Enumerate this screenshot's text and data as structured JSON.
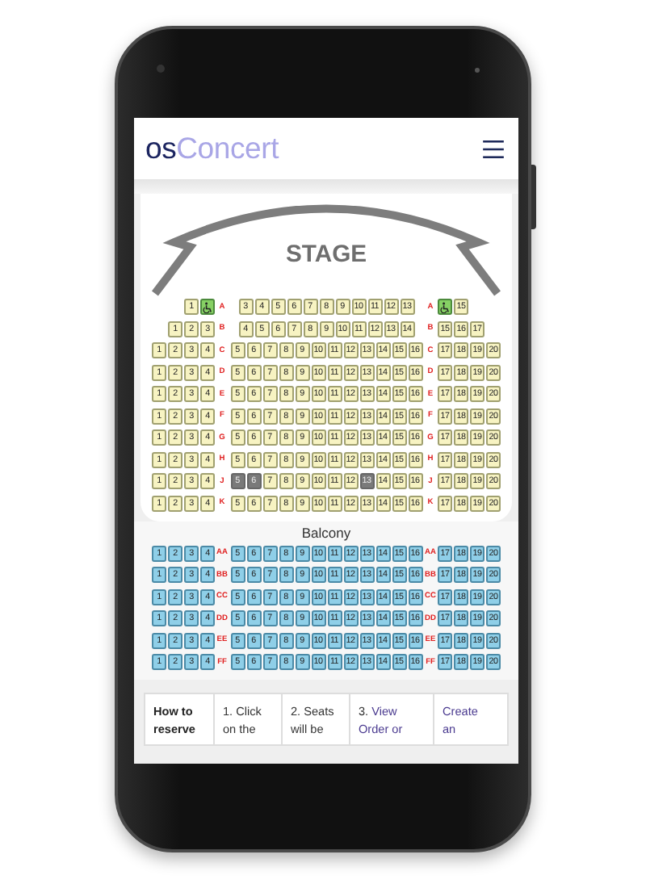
{
  "header": {
    "logo": {
      "dark_part": "os",
      "light_part": "Concert"
    }
  },
  "stage": {
    "label": "STAGE"
  },
  "orchestra": {
    "rows": [
      {
        "label_left": "A",
        "label_right": "A",
        "left": [
          {
            "kind": "seat",
            "label": "1",
            "sold": false
          },
          {
            "kind": "wheelchair",
            "sold": false
          }
        ],
        "center": [
          {
            "kind": "seat",
            "label": "3",
            "sold": false
          },
          {
            "kind": "seat",
            "label": "4",
            "sold": false
          },
          {
            "kind": "seat",
            "label": "5",
            "sold": false
          },
          {
            "kind": "seat",
            "label": "6",
            "sold": false
          },
          {
            "kind": "seat",
            "label": "7",
            "sold": false
          },
          {
            "kind": "seat",
            "label": "8",
            "sold": false
          },
          {
            "kind": "seat",
            "label": "9",
            "sold": false
          },
          {
            "kind": "seat",
            "label": "10",
            "sold": false
          },
          {
            "kind": "seat",
            "label": "11",
            "sold": false
          },
          {
            "kind": "seat",
            "label": "12",
            "sold": false
          },
          {
            "kind": "seat",
            "label": "13",
            "sold": false
          }
        ],
        "right": [
          {
            "kind": "wheelchair",
            "sold": false
          },
          {
            "kind": "seat",
            "label": "15",
            "sold": false
          }
        ]
      },
      {
        "label_left": "B",
        "label_right": "B",
        "left": [
          {
            "kind": "seat",
            "label": "1",
            "sold": false
          },
          {
            "kind": "seat",
            "label": "2",
            "sold": false
          },
          {
            "kind": "seat",
            "label": "3",
            "sold": false
          }
        ],
        "center": [
          {
            "kind": "seat",
            "label": "4",
            "sold": false
          },
          {
            "kind": "seat",
            "label": "5",
            "sold": false
          },
          {
            "kind": "seat",
            "label": "6",
            "sold": false
          },
          {
            "kind": "seat",
            "label": "7",
            "sold": false
          },
          {
            "kind": "seat",
            "label": "8",
            "sold": false
          },
          {
            "kind": "seat",
            "label": "9",
            "sold": false
          },
          {
            "kind": "seat",
            "label": "10",
            "sold": false
          },
          {
            "kind": "seat",
            "label": "11",
            "sold": false
          },
          {
            "kind": "seat",
            "label": "12",
            "sold": false
          },
          {
            "kind": "seat",
            "label": "13",
            "sold": false
          },
          {
            "kind": "seat",
            "label": "14",
            "sold": false
          }
        ],
        "right": [
          {
            "kind": "seat",
            "label": "15",
            "sold": false
          },
          {
            "kind": "seat",
            "label": "16",
            "sold": false
          },
          {
            "kind": "seat",
            "label": "17",
            "sold": false
          }
        ]
      },
      {
        "label_left": "C",
        "label_right": "C",
        "left": [
          {
            "kind": "seat",
            "label": "1",
            "sold": false
          },
          {
            "kind": "seat",
            "label": "2",
            "sold": false
          },
          {
            "kind": "seat",
            "label": "3",
            "sold": false
          },
          {
            "kind": "seat",
            "label": "4",
            "sold": false
          }
        ],
        "center": [
          {
            "kind": "seat",
            "label": "5",
            "sold": false
          },
          {
            "kind": "seat",
            "label": "6",
            "sold": false
          },
          {
            "kind": "seat",
            "label": "7",
            "sold": false
          },
          {
            "kind": "seat",
            "label": "8",
            "sold": false
          },
          {
            "kind": "seat",
            "label": "9",
            "sold": false
          },
          {
            "kind": "seat",
            "label": "10",
            "sold": false
          },
          {
            "kind": "seat",
            "label": "11",
            "sold": false
          },
          {
            "kind": "seat",
            "label": "12",
            "sold": false
          },
          {
            "kind": "seat",
            "label": "13",
            "sold": false
          },
          {
            "kind": "seat",
            "label": "14",
            "sold": false
          },
          {
            "kind": "seat",
            "label": "15",
            "sold": false
          },
          {
            "kind": "seat",
            "label": "16",
            "sold": false
          }
        ],
        "right": [
          {
            "kind": "seat",
            "label": "17",
            "sold": false
          },
          {
            "kind": "seat",
            "label": "18",
            "sold": false
          },
          {
            "kind": "seat",
            "label": "19",
            "sold": false
          },
          {
            "kind": "seat",
            "label": "20",
            "sold": false
          }
        ]
      },
      {
        "label_left": "D",
        "label_right": "D",
        "left": [
          {
            "kind": "seat",
            "label": "1",
            "sold": false
          },
          {
            "kind": "seat",
            "label": "2",
            "sold": false
          },
          {
            "kind": "seat",
            "label": "3",
            "sold": false
          },
          {
            "kind": "seat",
            "label": "4",
            "sold": false
          }
        ],
        "center": [
          {
            "kind": "seat",
            "label": "5",
            "sold": false
          },
          {
            "kind": "seat",
            "label": "6",
            "sold": false
          },
          {
            "kind": "seat",
            "label": "7",
            "sold": false
          },
          {
            "kind": "seat",
            "label": "8",
            "sold": false
          },
          {
            "kind": "seat",
            "label": "9",
            "sold": false
          },
          {
            "kind": "seat",
            "label": "10",
            "sold": false
          },
          {
            "kind": "seat",
            "label": "11",
            "sold": false
          },
          {
            "kind": "seat",
            "label": "12",
            "sold": false
          },
          {
            "kind": "seat",
            "label": "13",
            "sold": false
          },
          {
            "kind": "seat",
            "label": "14",
            "sold": false
          },
          {
            "kind": "seat",
            "label": "15",
            "sold": false
          },
          {
            "kind": "seat",
            "label": "16",
            "sold": false
          }
        ],
        "right": [
          {
            "kind": "seat",
            "label": "17",
            "sold": false
          },
          {
            "kind": "seat",
            "label": "18",
            "sold": false
          },
          {
            "kind": "seat",
            "label": "19",
            "sold": false
          },
          {
            "kind": "seat",
            "label": "20",
            "sold": false
          }
        ]
      },
      {
        "label_left": "E",
        "label_right": "E",
        "left": [
          {
            "kind": "seat",
            "label": "1",
            "sold": false
          },
          {
            "kind": "seat",
            "label": "2",
            "sold": false
          },
          {
            "kind": "seat",
            "label": "3",
            "sold": false
          },
          {
            "kind": "seat",
            "label": "4",
            "sold": false
          }
        ],
        "center": [
          {
            "kind": "seat",
            "label": "5",
            "sold": false
          },
          {
            "kind": "seat",
            "label": "6",
            "sold": false
          },
          {
            "kind": "seat",
            "label": "7",
            "sold": false
          },
          {
            "kind": "seat",
            "label": "8",
            "sold": false
          },
          {
            "kind": "seat",
            "label": "9",
            "sold": false
          },
          {
            "kind": "seat",
            "label": "10",
            "sold": false
          },
          {
            "kind": "seat",
            "label": "11",
            "sold": false
          },
          {
            "kind": "seat",
            "label": "12",
            "sold": false
          },
          {
            "kind": "seat",
            "label": "13",
            "sold": false
          },
          {
            "kind": "seat",
            "label": "14",
            "sold": false
          },
          {
            "kind": "seat",
            "label": "15",
            "sold": false
          },
          {
            "kind": "seat",
            "label": "16",
            "sold": false
          }
        ],
        "right": [
          {
            "kind": "seat",
            "label": "17",
            "sold": false
          },
          {
            "kind": "seat",
            "label": "18",
            "sold": false
          },
          {
            "kind": "seat",
            "label": "19",
            "sold": false
          },
          {
            "kind": "seat",
            "label": "20",
            "sold": false
          }
        ]
      },
      {
        "label_left": "F",
        "label_right": "F",
        "left": [
          {
            "kind": "seat",
            "label": "1",
            "sold": false
          },
          {
            "kind": "seat",
            "label": "2",
            "sold": false
          },
          {
            "kind": "seat",
            "label": "3",
            "sold": false
          },
          {
            "kind": "seat",
            "label": "4",
            "sold": false
          }
        ],
        "center": [
          {
            "kind": "seat",
            "label": "5",
            "sold": false
          },
          {
            "kind": "seat",
            "label": "6",
            "sold": false
          },
          {
            "kind": "seat",
            "label": "7",
            "sold": false
          },
          {
            "kind": "seat",
            "label": "8",
            "sold": false
          },
          {
            "kind": "seat",
            "label": "9",
            "sold": false
          },
          {
            "kind": "seat",
            "label": "10",
            "sold": false
          },
          {
            "kind": "seat",
            "label": "11",
            "sold": false
          },
          {
            "kind": "seat",
            "label": "12",
            "sold": false
          },
          {
            "kind": "seat",
            "label": "13",
            "sold": false
          },
          {
            "kind": "seat",
            "label": "14",
            "sold": false
          },
          {
            "kind": "seat",
            "label": "15",
            "sold": false
          },
          {
            "kind": "seat",
            "label": "16",
            "sold": false
          }
        ],
        "right": [
          {
            "kind": "seat",
            "label": "17",
            "sold": false
          },
          {
            "kind": "seat",
            "label": "18",
            "sold": false
          },
          {
            "kind": "seat",
            "label": "19",
            "sold": false
          },
          {
            "kind": "seat",
            "label": "20",
            "sold": false
          }
        ]
      },
      {
        "label_left": "G",
        "label_right": "G",
        "left": [
          {
            "kind": "seat",
            "label": "1",
            "sold": false
          },
          {
            "kind": "seat",
            "label": "2",
            "sold": false
          },
          {
            "kind": "seat",
            "label": "3",
            "sold": false
          },
          {
            "kind": "seat",
            "label": "4",
            "sold": false
          }
        ],
        "center": [
          {
            "kind": "seat",
            "label": "5",
            "sold": false
          },
          {
            "kind": "seat",
            "label": "6",
            "sold": false
          },
          {
            "kind": "seat",
            "label": "7",
            "sold": false
          },
          {
            "kind": "seat",
            "label": "8",
            "sold": false
          },
          {
            "kind": "seat",
            "label": "9",
            "sold": false
          },
          {
            "kind": "seat",
            "label": "10",
            "sold": false
          },
          {
            "kind": "seat",
            "label": "11",
            "sold": false
          },
          {
            "kind": "seat",
            "label": "12",
            "sold": false
          },
          {
            "kind": "seat",
            "label": "13",
            "sold": false
          },
          {
            "kind": "seat",
            "label": "14",
            "sold": false
          },
          {
            "kind": "seat",
            "label": "15",
            "sold": false
          },
          {
            "kind": "seat",
            "label": "16",
            "sold": false
          }
        ],
        "right": [
          {
            "kind": "seat",
            "label": "17",
            "sold": false
          },
          {
            "kind": "seat",
            "label": "18",
            "sold": false
          },
          {
            "kind": "seat",
            "label": "19",
            "sold": false
          },
          {
            "kind": "seat",
            "label": "20",
            "sold": false
          }
        ]
      },
      {
        "label_left": "H",
        "label_right": "H",
        "left": [
          {
            "kind": "seat",
            "label": "1",
            "sold": false
          },
          {
            "kind": "seat",
            "label": "2",
            "sold": false
          },
          {
            "kind": "seat",
            "label": "3",
            "sold": false
          },
          {
            "kind": "seat",
            "label": "4",
            "sold": false
          }
        ],
        "center": [
          {
            "kind": "seat",
            "label": "5",
            "sold": false
          },
          {
            "kind": "seat",
            "label": "6",
            "sold": false
          },
          {
            "kind": "seat",
            "label": "7",
            "sold": false
          },
          {
            "kind": "seat",
            "label": "8",
            "sold": false
          },
          {
            "kind": "seat",
            "label": "9",
            "sold": false
          },
          {
            "kind": "seat",
            "label": "10",
            "sold": false
          },
          {
            "kind": "seat",
            "label": "11",
            "sold": false
          },
          {
            "kind": "seat",
            "label": "12",
            "sold": false
          },
          {
            "kind": "seat",
            "label": "13",
            "sold": false
          },
          {
            "kind": "seat",
            "label": "14",
            "sold": false
          },
          {
            "kind": "seat",
            "label": "15",
            "sold": false
          },
          {
            "kind": "seat",
            "label": "16",
            "sold": false
          }
        ],
        "right": [
          {
            "kind": "seat",
            "label": "17",
            "sold": false
          },
          {
            "kind": "seat",
            "label": "18",
            "sold": false
          },
          {
            "kind": "seat",
            "label": "19",
            "sold": false
          },
          {
            "kind": "seat",
            "label": "20",
            "sold": false
          }
        ]
      },
      {
        "label_left": "J",
        "label_right": "J",
        "left": [
          {
            "kind": "seat",
            "label": "1",
            "sold": false
          },
          {
            "kind": "seat",
            "label": "2",
            "sold": false
          },
          {
            "kind": "seat",
            "label": "3",
            "sold": false
          },
          {
            "kind": "seat",
            "label": "4",
            "sold": false
          }
        ],
        "center": [
          {
            "kind": "seat",
            "label": "5",
            "sold": true
          },
          {
            "kind": "seat",
            "label": "6",
            "sold": true
          },
          {
            "kind": "seat",
            "label": "7",
            "sold": false
          },
          {
            "kind": "seat",
            "label": "8",
            "sold": false
          },
          {
            "kind": "seat",
            "label": "9",
            "sold": false
          },
          {
            "kind": "seat",
            "label": "10",
            "sold": false
          },
          {
            "kind": "seat",
            "label": "11",
            "sold": false
          },
          {
            "kind": "seat",
            "label": "12",
            "sold": false
          },
          {
            "kind": "seat",
            "label": "13",
            "sold": true
          },
          {
            "kind": "seat",
            "label": "14",
            "sold": false
          },
          {
            "kind": "seat",
            "label": "15",
            "sold": false
          },
          {
            "kind": "seat",
            "label": "16",
            "sold": false
          }
        ],
        "right": [
          {
            "kind": "seat",
            "label": "17",
            "sold": false
          },
          {
            "kind": "seat",
            "label": "18",
            "sold": false
          },
          {
            "kind": "seat",
            "label": "19",
            "sold": false
          },
          {
            "kind": "seat",
            "label": "20",
            "sold": false
          }
        ]
      },
      {
        "label_left": "K",
        "label_right": "K",
        "left": [
          {
            "kind": "seat",
            "label": "1",
            "sold": false
          },
          {
            "kind": "seat",
            "label": "2",
            "sold": false
          },
          {
            "kind": "seat",
            "label": "3",
            "sold": false
          },
          {
            "kind": "seat",
            "label": "4",
            "sold": false
          }
        ],
        "center": [
          {
            "kind": "seat",
            "label": "5",
            "sold": false
          },
          {
            "kind": "seat",
            "label": "6",
            "sold": false
          },
          {
            "kind": "seat",
            "label": "7",
            "sold": false
          },
          {
            "kind": "seat",
            "label": "8",
            "sold": false
          },
          {
            "kind": "seat",
            "label": "9",
            "sold": false
          },
          {
            "kind": "seat",
            "label": "10",
            "sold": false
          },
          {
            "kind": "seat",
            "label": "11",
            "sold": false
          },
          {
            "kind": "seat",
            "label": "12",
            "sold": false
          },
          {
            "kind": "seat",
            "label": "13",
            "sold": false
          },
          {
            "kind": "seat",
            "label": "14",
            "sold": false
          },
          {
            "kind": "seat",
            "label": "15",
            "sold": false
          },
          {
            "kind": "seat",
            "label": "16",
            "sold": false
          }
        ],
        "right": [
          {
            "kind": "seat",
            "label": "17",
            "sold": false
          },
          {
            "kind": "seat",
            "label": "18",
            "sold": false
          },
          {
            "kind": "seat",
            "label": "19",
            "sold": false
          },
          {
            "kind": "seat",
            "label": "20",
            "sold": false
          }
        ]
      }
    ]
  },
  "balcony": {
    "title": "Balcony",
    "rows": [
      {
        "label_left": "AA",
        "label_right": "AA",
        "left": [
          {
            "kind": "seat",
            "label": "1",
            "sold": false
          },
          {
            "kind": "seat",
            "label": "2",
            "sold": false
          },
          {
            "kind": "seat",
            "label": "3",
            "sold": false
          },
          {
            "kind": "seat",
            "label": "4",
            "sold": false
          }
        ],
        "center": [
          {
            "kind": "seat",
            "label": "5",
            "sold": false
          },
          {
            "kind": "seat",
            "label": "6",
            "sold": false
          },
          {
            "kind": "seat",
            "label": "7",
            "sold": false
          },
          {
            "kind": "seat",
            "label": "8",
            "sold": false
          },
          {
            "kind": "seat",
            "label": "9",
            "sold": false
          },
          {
            "kind": "seat",
            "label": "10",
            "sold": false
          },
          {
            "kind": "seat",
            "label": "11",
            "sold": false
          },
          {
            "kind": "seat",
            "label": "12",
            "sold": false
          },
          {
            "kind": "seat",
            "label": "13",
            "sold": false
          },
          {
            "kind": "seat",
            "label": "14",
            "sold": false
          },
          {
            "kind": "seat",
            "label": "15",
            "sold": false
          },
          {
            "kind": "seat",
            "label": "16",
            "sold": false
          }
        ],
        "right": [
          {
            "kind": "seat",
            "label": "17",
            "sold": false
          },
          {
            "kind": "seat",
            "label": "18",
            "sold": false
          },
          {
            "kind": "seat",
            "label": "19",
            "sold": false
          },
          {
            "kind": "seat",
            "label": "20",
            "sold": false
          }
        ]
      },
      {
        "label_left": "BB",
        "label_right": "BB",
        "left": [
          {
            "kind": "seat",
            "label": "1",
            "sold": false
          },
          {
            "kind": "seat",
            "label": "2",
            "sold": false
          },
          {
            "kind": "seat",
            "label": "3",
            "sold": false
          },
          {
            "kind": "seat",
            "label": "4",
            "sold": false
          }
        ],
        "center": [
          {
            "kind": "seat",
            "label": "5",
            "sold": false
          },
          {
            "kind": "seat",
            "label": "6",
            "sold": false
          },
          {
            "kind": "seat",
            "label": "7",
            "sold": false
          },
          {
            "kind": "seat",
            "label": "8",
            "sold": false
          },
          {
            "kind": "seat",
            "label": "9",
            "sold": false
          },
          {
            "kind": "seat",
            "label": "10",
            "sold": false
          },
          {
            "kind": "seat",
            "label": "11",
            "sold": false
          },
          {
            "kind": "seat",
            "label": "12",
            "sold": false
          },
          {
            "kind": "seat",
            "label": "13",
            "sold": false
          },
          {
            "kind": "seat",
            "label": "14",
            "sold": false
          },
          {
            "kind": "seat",
            "label": "15",
            "sold": false
          },
          {
            "kind": "seat",
            "label": "16",
            "sold": false
          }
        ],
        "right": [
          {
            "kind": "seat",
            "label": "17",
            "sold": false
          },
          {
            "kind": "seat",
            "label": "18",
            "sold": false
          },
          {
            "kind": "seat",
            "label": "19",
            "sold": false
          },
          {
            "kind": "seat",
            "label": "20",
            "sold": false
          }
        ]
      },
      {
        "label_left": "CC",
        "label_right": "CC",
        "left": [
          {
            "kind": "seat",
            "label": "1",
            "sold": false
          },
          {
            "kind": "seat",
            "label": "2",
            "sold": false
          },
          {
            "kind": "seat",
            "label": "3",
            "sold": false
          },
          {
            "kind": "seat",
            "label": "4",
            "sold": false
          }
        ],
        "center": [
          {
            "kind": "seat",
            "label": "5",
            "sold": false
          },
          {
            "kind": "seat",
            "label": "6",
            "sold": false
          },
          {
            "kind": "seat",
            "label": "7",
            "sold": false
          },
          {
            "kind": "seat",
            "label": "8",
            "sold": false
          },
          {
            "kind": "seat",
            "label": "9",
            "sold": false
          },
          {
            "kind": "seat",
            "label": "10",
            "sold": false
          },
          {
            "kind": "seat",
            "label": "11",
            "sold": false
          },
          {
            "kind": "seat",
            "label": "12",
            "sold": false
          },
          {
            "kind": "seat",
            "label": "13",
            "sold": false
          },
          {
            "kind": "seat",
            "label": "14",
            "sold": false
          },
          {
            "kind": "seat",
            "label": "15",
            "sold": false
          },
          {
            "kind": "seat",
            "label": "16",
            "sold": false
          }
        ],
        "right": [
          {
            "kind": "seat",
            "label": "17",
            "sold": false
          },
          {
            "kind": "seat",
            "label": "18",
            "sold": false
          },
          {
            "kind": "seat",
            "label": "19",
            "sold": false
          },
          {
            "kind": "seat",
            "label": "20",
            "sold": false
          }
        ]
      },
      {
        "label_left": "DD",
        "label_right": "DD",
        "left": [
          {
            "kind": "seat",
            "label": "1",
            "sold": false
          },
          {
            "kind": "seat",
            "label": "2",
            "sold": false
          },
          {
            "kind": "seat",
            "label": "3",
            "sold": false
          },
          {
            "kind": "seat",
            "label": "4",
            "sold": false
          }
        ],
        "center": [
          {
            "kind": "seat",
            "label": "5",
            "sold": false
          },
          {
            "kind": "seat",
            "label": "6",
            "sold": false
          },
          {
            "kind": "seat",
            "label": "7",
            "sold": false
          },
          {
            "kind": "seat",
            "label": "8",
            "sold": false
          },
          {
            "kind": "seat",
            "label": "9",
            "sold": false
          },
          {
            "kind": "seat",
            "label": "10",
            "sold": false
          },
          {
            "kind": "seat",
            "label": "11",
            "sold": false
          },
          {
            "kind": "seat",
            "label": "12",
            "sold": false
          },
          {
            "kind": "seat",
            "label": "13",
            "sold": false
          },
          {
            "kind": "seat",
            "label": "14",
            "sold": false
          },
          {
            "kind": "seat",
            "label": "15",
            "sold": false
          },
          {
            "kind": "seat",
            "label": "16",
            "sold": false
          }
        ],
        "right": [
          {
            "kind": "seat",
            "label": "17",
            "sold": false
          },
          {
            "kind": "seat",
            "label": "18",
            "sold": false
          },
          {
            "kind": "seat",
            "label": "19",
            "sold": false
          },
          {
            "kind": "seat",
            "label": "20",
            "sold": false
          }
        ]
      },
      {
        "label_left": "EE",
        "label_right": "EE",
        "left": [
          {
            "kind": "seat",
            "label": "1",
            "sold": false
          },
          {
            "kind": "seat",
            "label": "2",
            "sold": false
          },
          {
            "kind": "seat",
            "label": "3",
            "sold": false
          },
          {
            "kind": "seat",
            "label": "4",
            "sold": false
          }
        ],
        "center": [
          {
            "kind": "seat",
            "label": "5",
            "sold": false
          },
          {
            "kind": "seat",
            "label": "6",
            "sold": false
          },
          {
            "kind": "seat",
            "label": "7",
            "sold": false
          },
          {
            "kind": "seat",
            "label": "8",
            "sold": false
          },
          {
            "kind": "seat",
            "label": "9",
            "sold": false
          },
          {
            "kind": "seat",
            "label": "10",
            "sold": false
          },
          {
            "kind": "seat",
            "label": "11",
            "sold": false
          },
          {
            "kind": "seat",
            "label": "12",
            "sold": false
          },
          {
            "kind": "seat",
            "label": "13",
            "sold": false
          },
          {
            "kind": "seat",
            "label": "14",
            "sold": false
          },
          {
            "kind": "seat",
            "label": "15",
            "sold": false
          },
          {
            "kind": "seat",
            "label": "16",
            "sold": false
          }
        ],
        "right": [
          {
            "kind": "seat",
            "label": "17",
            "sold": false
          },
          {
            "kind": "seat",
            "label": "18",
            "sold": false
          },
          {
            "kind": "seat",
            "label": "19",
            "sold": false
          },
          {
            "kind": "seat",
            "label": "20",
            "sold": false
          }
        ]
      },
      {
        "label_left": "FF",
        "label_right": "FF",
        "left": [
          {
            "kind": "seat",
            "label": "1",
            "sold": false
          },
          {
            "kind": "seat",
            "label": "2",
            "sold": false
          },
          {
            "kind": "seat",
            "label": "3",
            "sold": false
          },
          {
            "kind": "seat",
            "label": "4",
            "sold": false
          }
        ],
        "center": [
          {
            "kind": "seat",
            "label": "5",
            "sold": false
          },
          {
            "kind": "seat",
            "label": "6",
            "sold": false
          },
          {
            "kind": "seat",
            "label": "7",
            "sold": false
          },
          {
            "kind": "seat",
            "label": "8",
            "sold": false
          },
          {
            "kind": "seat",
            "label": "9",
            "sold": false
          },
          {
            "kind": "seat",
            "label": "10",
            "sold": false
          },
          {
            "kind": "seat",
            "label": "11",
            "sold": false
          },
          {
            "kind": "seat",
            "label": "12",
            "sold": false
          },
          {
            "kind": "seat",
            "label": "13",
            "sold": false
          },
          {
            "kind": "seat",
            "label": "14",
            "sold": false
          },
          {
            "kind": "seat",
            "label": "15",
            "sold": false
          },
          {
            "kind": "seat",
            "label": "16",
            "sold": false
          }
        ],
        "right": [
          {
            "kind": "seat",
            "label": "17",
            "sold": false
          },
          {
            "kind": "seat",
            "label": "18",
            "sold": false
          },
          {
            "kind": "seat",
            "label": "19",
            "sold": false
          },
          {
            "kind": "seat",
            "label": "20",
            "sold": false
          }
        ]
      }
    ]
  },
  "instructions": {
    "cells": [
      {
        "kind": "heading",
        "text": "How to reserve"
      },
      {
        "kind": "text",
        "text": "1. Click on the"
      },
      {
        "kind": "text",
        "text": "2. Seats will be"
      },
      {
        "kind": "step_link",
        "text": "3.",
        "link": "View Order or"
      },
      {
        "kind": "link",
        "link": "Create an"
      }
    ]
  }
}
